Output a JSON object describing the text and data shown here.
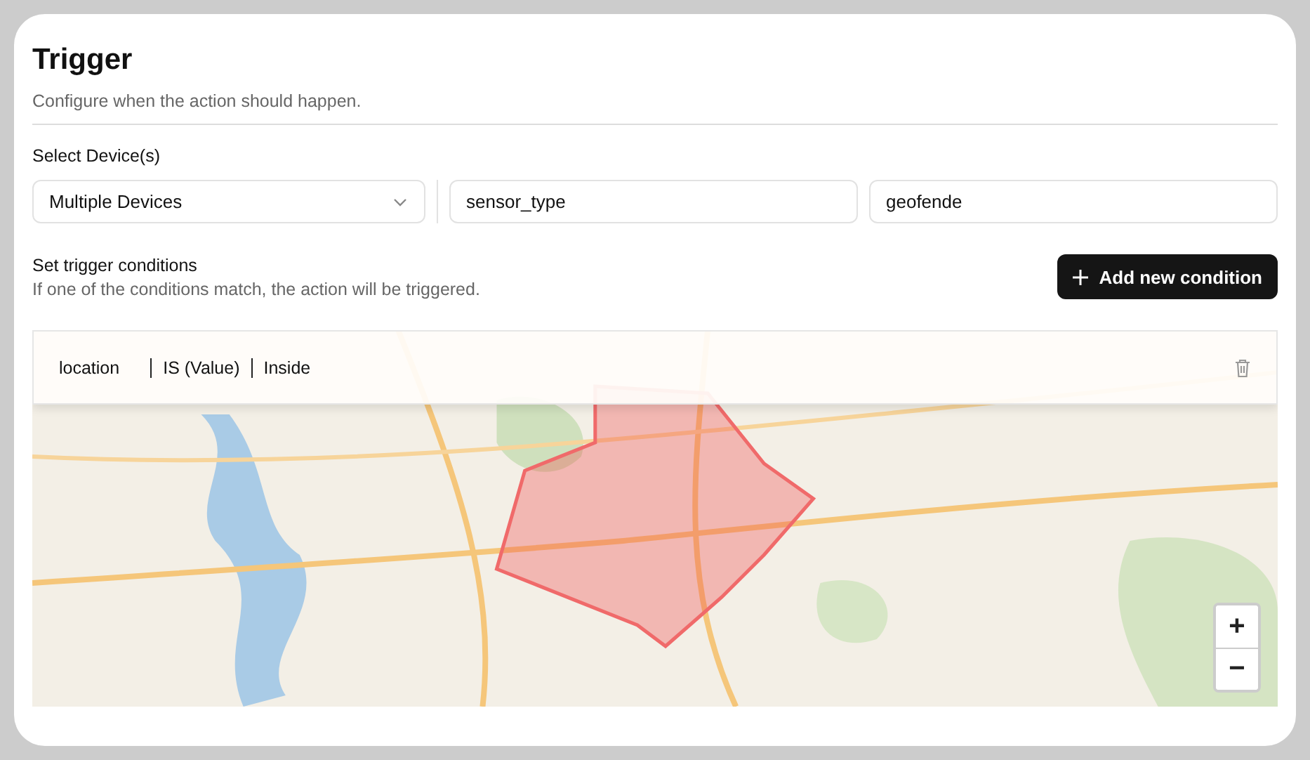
{
  "title": "Trigger",
  "description": "Configure when the action should happen.",
  "device_label": "Select Device(s)",
  "device_select": {
    "value": "Multiple Devices"
  },
  "fields": [
    {
      "value": "sensor_type"
    },
    {
      "value": "geofende"
    }
  ],
  "conditions_title": "Set trigger conditions",
  "conditions_hint": "If one of the conditions match, the action will be triggered.",
  "add_button": "Add new condition",
  "map": {
    "kind": "picture",
    "condition": {
      "field": "location",
      "operator": "IS (Value)",
      "value": "Inside"
    },
    "zoom_controls": [
      "+",
      "−"
    ]
  }
}
